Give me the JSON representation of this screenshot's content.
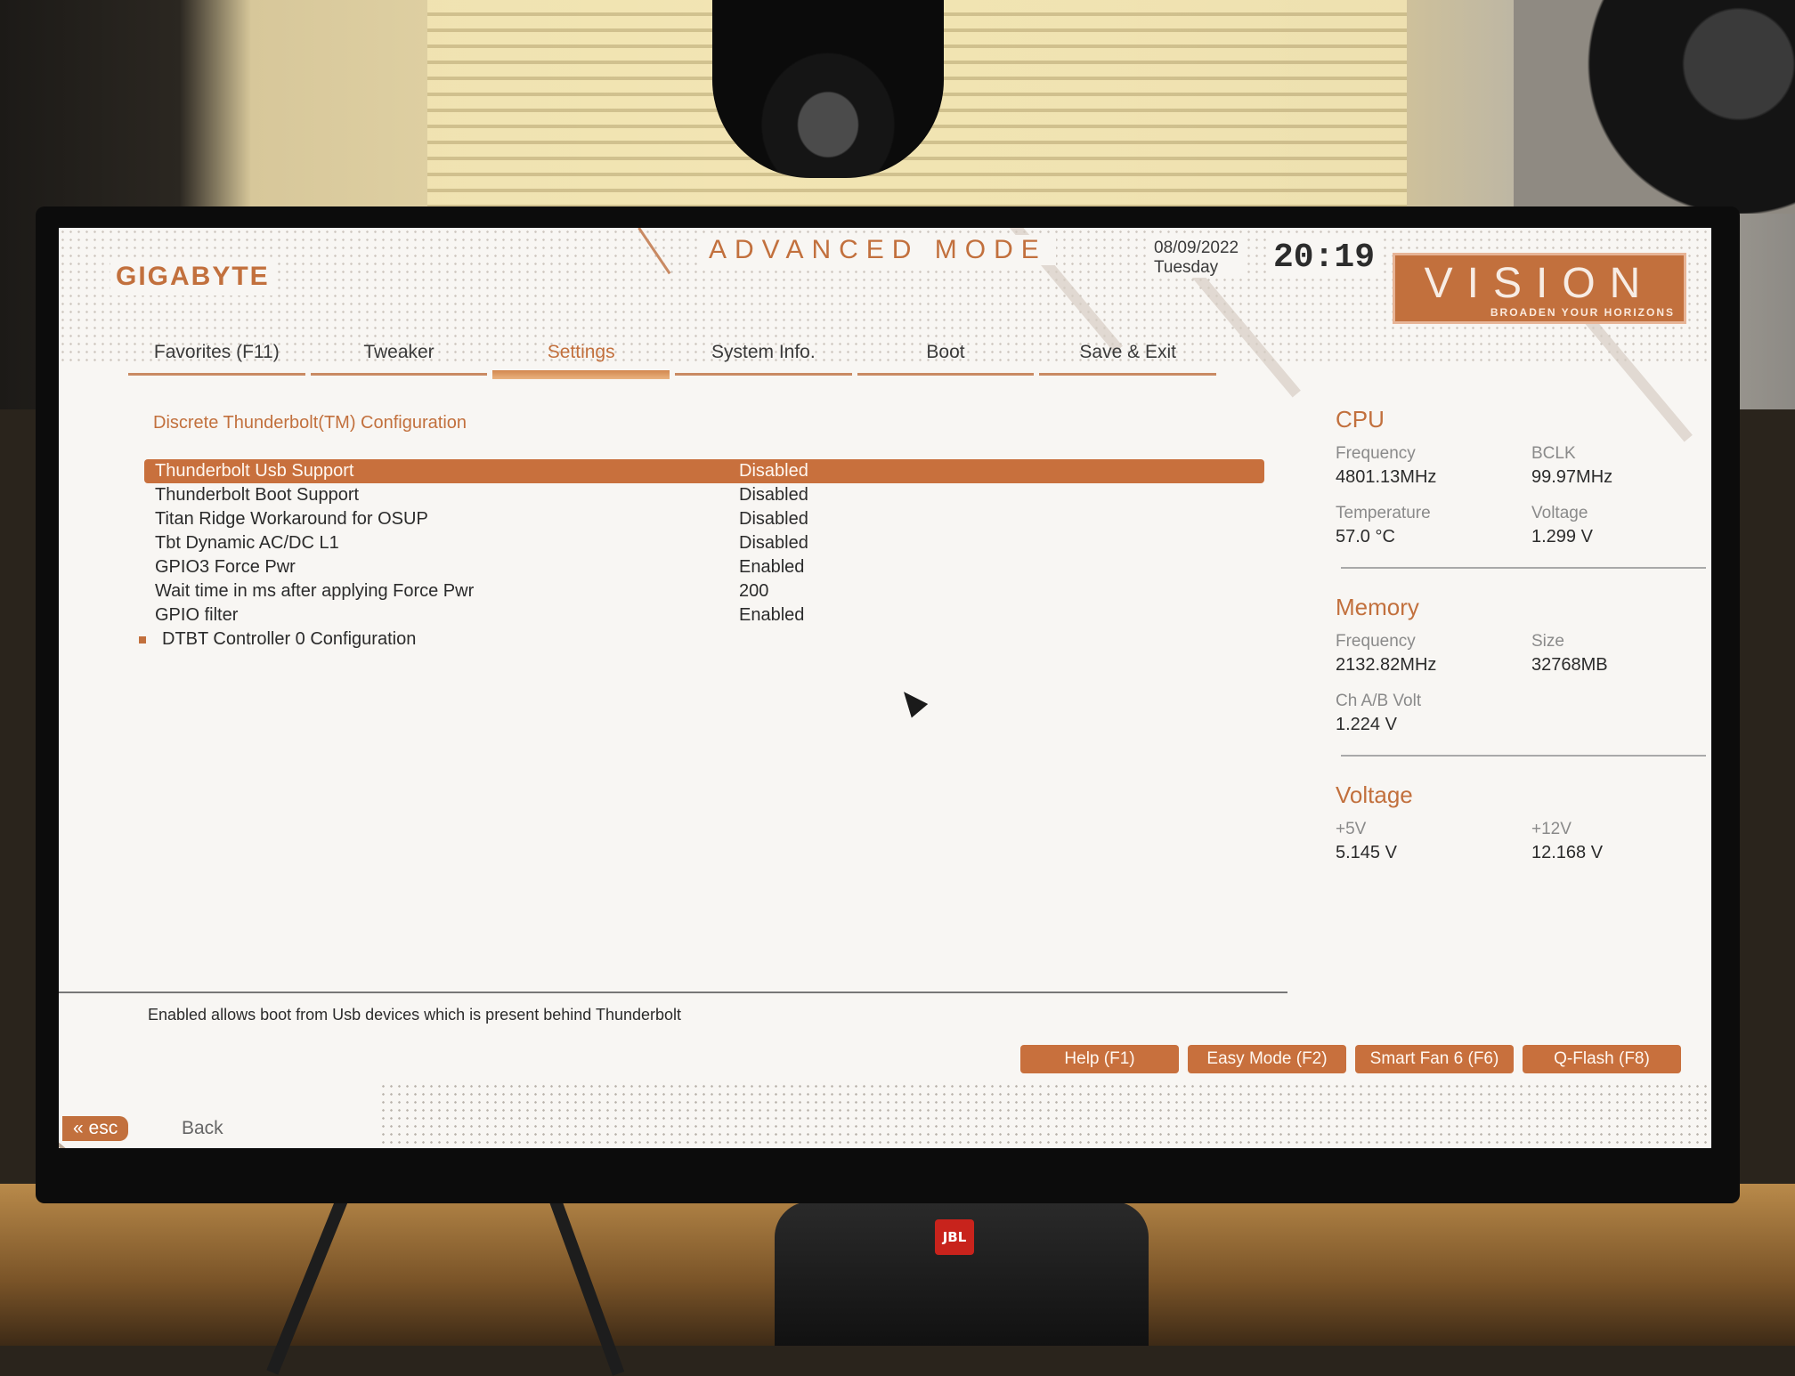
{
  "header": {
    "brand": "GIGABYTE",
    "mode": "ADVANCED MODE",
    "date": "08/09/2022",
    "weekday": "Tuesday",
    "time": "20:19",
    "vision_word": "VISION",
    "vision_tagline": "BROADEN YOUR HORIZONS"
  },
  "tabs": [
    {
      "label": "Favorites (F11)"
    },
    {
      "label": "Tweaker"
    },
    {
      "label": "Settings"
    },
    {
      "label": "System Info."
    },
    {
      "label": "Boot"
    },
    {
      "label": "Save & Exit"
    }
  ],
  "active_tab": "Settings",
  "section_title": "Discrete Thunderbolt(TM) Configuration",
  "settings": [
    {
      "label": "Thunderbolt Usb Support",
      "value": "Disabled"
    },
    {
      "label": "Thunderbolt Boot Support",
      "value": "Disabled"
    },
    {
      "label": "Titan Ridge Workaround for OSUP",
      "value": "Disabled"
    },
    {
      "label": "Tbt Dynamic AC/DC L1",
      "value": "Disabled"
    },
    {
      "label": "GPIO3 Force Pwr",
      "value": "Enabled"
    },
    {
      "label": "Wait time in ms after applying Force Pwr",
      "value": "200"
    },
    {
      "label": "GPIO filter",
      "value": "Enabled"
    },
    {
      "label": "DTBT Controller 0 Configuration",
      "value": ""
    }
  ],
  "selected_setting": "Thunderbolt Usb Support",
  "info": {
    "cpu": {
      "title": "CPU",
      "freq_label": "Frequency",
      "freq_value": "4801.13MHz",
      "bclk_label": "BCLK",
      "bclk_value": "99.97MHz",
      "temp_label": "Temperature",
      "temp_value": "57.0 °C",
      "volt_label": "Voltage",
      "volt_value": "1.299 V"
    },
    "memory": {
      "title": "Memory",
      "freq_label": "Frequency",
      "freq_value": "2132.82MHz",
      "size_label": "Size",
      "size_value": "32768MB",
      "volt_label": "Ch A/B Volt",
      "volt_value": "1.224 V"
    },
    "voltage": {
      "title": "Voltage",
      "v5_label": "+5V",
      "v5_value": "5.145 V",
      "v12_label": "+12V",
      "v12_value": "12.168 V"
    }
  },
  "help_text": "Enabled allows boot from Usb devices which is present behind Thunderbolt",
  "function_buttons": [
    {
      "label": "Help (F1)"
    },
    {
      "label": "Easy Mode (F2)"
    },
    {
      "label": "Smart Fan 6 (F6)"
    },
    {
      "label": "Q-Flash (F8)"
    }
  ],
  "esc_label": "esc",
  "back_label": "Back",
  "speaker_brand": "JBL",
  "colors": {
    "accent": "#c8703d",
    "background": "#f8f6f3",
    "text": "#2b2b2b"
  }
}
